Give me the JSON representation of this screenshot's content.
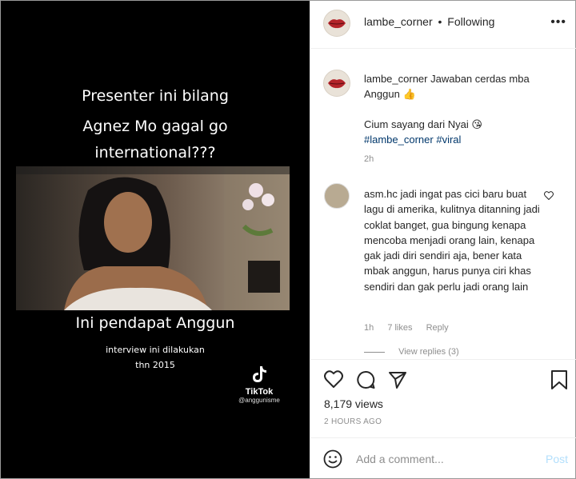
{
  "video": {
    "headline": [
      "Presenter ini bilang",
      "Agnez Mo gagal go",
      "international???"
    ],
    "subtitle": "Ini pendapat Anggun",
    "note": [
      "interview ini dilakukan",
      "thn 2015"
    ],
    "tiktok_label": "TikTok",
    "tiktok_handle": "@anggunisme"
  },
  "header": {
    "username": "lambe_corner",
    "separator": "•",
    "follow_status": "Following",
    "more_icon": "more-horizontal-icon"
  },
  "caption": {
    "username": "lambe_corner",
    "text": "Jawaban cerdas mba Anggun",
    "emoji_1": "👍",
    "line2": "Cium sayang dari Nyai",
    "emoji_2": "😘",
    "hashtag_1": "#lambe_corner",
    "hashtag_2": "#viral",
    "time": "2h"
  },
  "comment": {
    "username": "asm.hc",
    "text": "jadi ingat pas cici baru buat lagu di amerika, kulitnya ditanning jadi coklat banget, gua bingung kenapa mencoba menjadi orang lain, kenapa gak jadi diri sendiri aja, bener kata mbak anggun, harus punya ciri khas sendiri dan gak perlu jadi orang lain",
    "time": "1h",
    "likes": "7 likes",
    "reply": "Reply",
    "view_replies": "View replies (3)"
  },
  "stats": {
    "views": "8,179 views",
    "posted": "2 HOURS AGO"
  },
  "add_comment": {
    "placeholder": "Add a comment...",
    "post_label": "Post"
  }
}
